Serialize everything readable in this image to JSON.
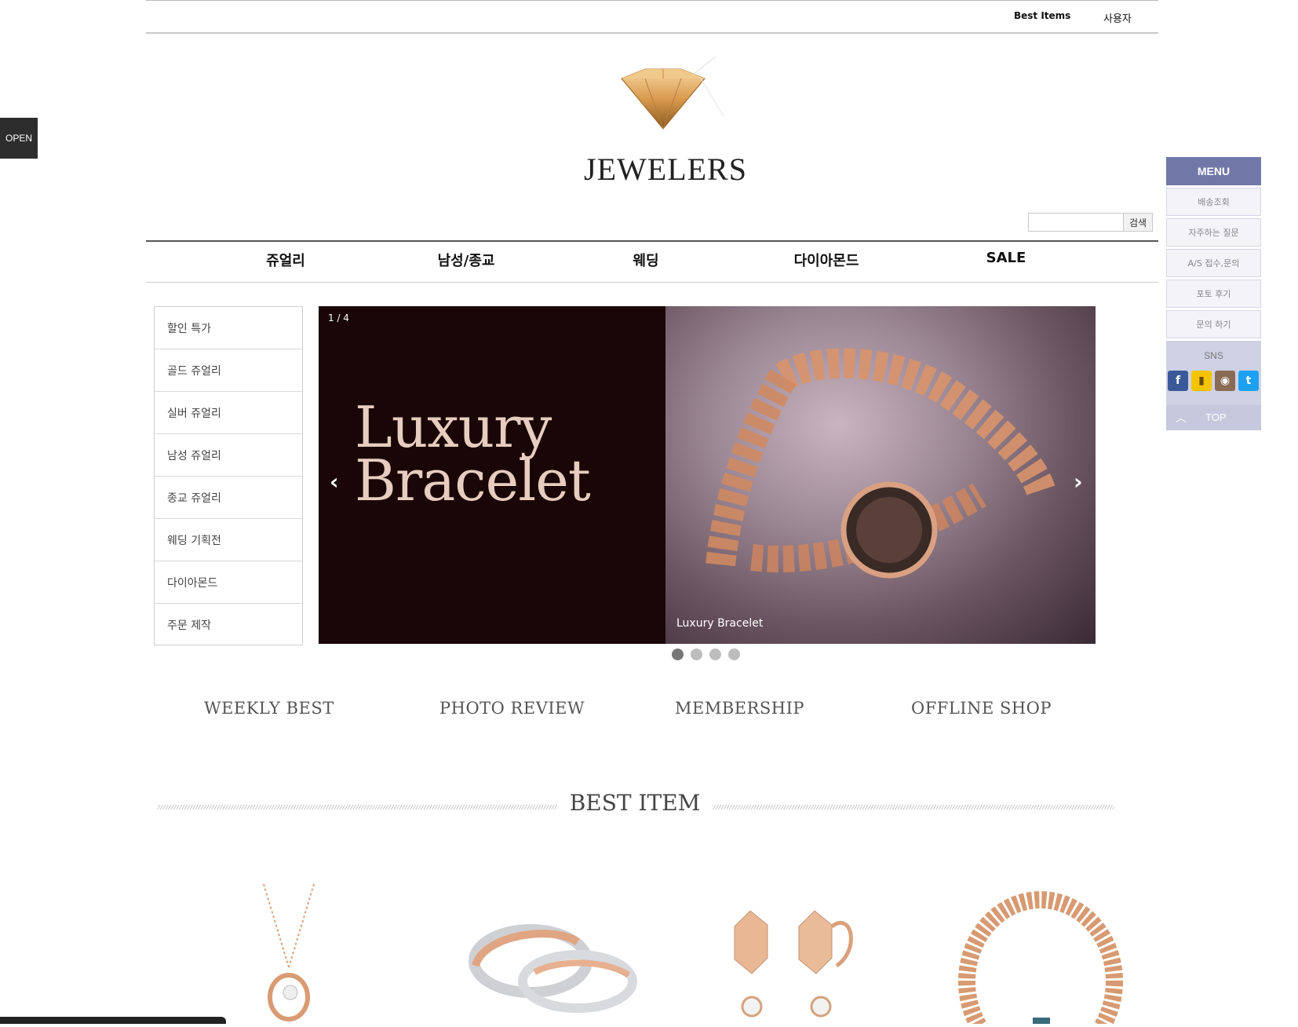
{
  "utility": {
    "best_items": "Best Items",
    "user": "사용자"
  },
  "open_tab": "OPEN",
  "logo": {
    "text": "JEWELERS"
  },
  "search": {
    "button": "검색",
    "placeholder": ""
  },
  "main_nav": [
    "쥬얼리",
    "남성/종교",
    "웨딩",
    "다이아몬드",
    "SALE"
  ],
  "categories": [
    "할인 특가",
    "골드 쥬얼리",
    "실버 쥬얼리",
    "남성 쥬얼리",
    "종교 쥬얼리",
    "웨딩 기획전",
    "다이아몬드",
    "주문 제작"
  ],
  "banner": {
    "counter": "1 / 4",
    "title_line1": "Luxury",
    "title_line2": "Bracelet",
    "caption": "Luxury Bracelet",
    "prev": "‹",
    "next": "›",
    "slide_count": 4,
    "active_slide": 1
  },
  "quick_menu": {
    "header": "MENU",
    "items": [
      "배송조회",
      "자주하는 질문",
      "A/S 접수,문의",
      "포토 후기",
      "문의 하기"
    ],
    "sns_label": "SNS",
    "sns": [
      "facebook-icon",
      "kakaostory-icon",
      "instagram-icon",
      "twitter-icon"
    ],
    "top": "TOP"
  },
  "quick_links": [
    "WEEKLY BEST",
    "PHOTO REVIEW",
    "MEMBERSHIP",
    "OFFLINE SHOP"
  ],
  "best_section": {
    "title": "BEST ITEM"
  },
  "products": [
    "necklace",
    "couple-rings",
    "earrings",
    "bracelet"
  ],
  "colors": {
    "menu_accent": "#7178a8",
    "banner_bg": "#1a0606",
    "banner_title": "#e7cdbf"
  }
}
